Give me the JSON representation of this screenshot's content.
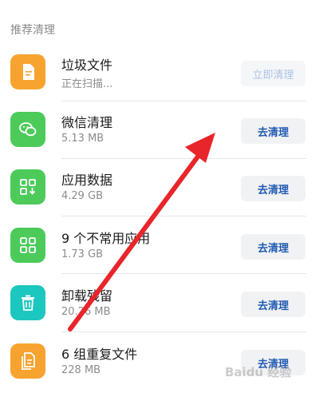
{
  "section": {
    "title": "推荐清理"
  },
  "items": [
    {
      "title": "垃圾文件",
      "subtitle": "正在扫描...",
      "button": "立即清理",
      "icon": "file-icon",
      "color": "#f7a32f"
    },
    {
      "title": "微信清理",
      "subtitle": "5.13 MB",
      "button": "去清理",
      "icon": "wechat-icon",
      "color": "#4ccb5b"
    },
    {
      "title": "应用数据",
      "subtitle": "4.29 GB",
      "button": "去清理",
      "icon": "app-data-icon",
      "color": "#4ccb5b"
    },
    {
      "title": "9 个不常用应用",
      "subtitle": "1.73 GB",
      "button": "去清理",
      "icon": "apps-grid-icon",
      "color": "#4ccb5b"
    },
    {
      "title": "卸载残留",
      "subtitle": "20.26 MB",
      "button": "去清理",
      "icon": "trash-icon",
      "color": "#1cc7c0"
    },
    {
      "title": "6 组重复文件",
      "subtitle": "228 MB",
      "button": "去清理",
      "icon": "duplicate-file-icon",
      "color": "#f7a32f"
    }
  ],
  "annotation": {
    "arrow_color": "#e8252a"
  },
  "watermark": {
    "text": "Baidu 经验"
  }
}
